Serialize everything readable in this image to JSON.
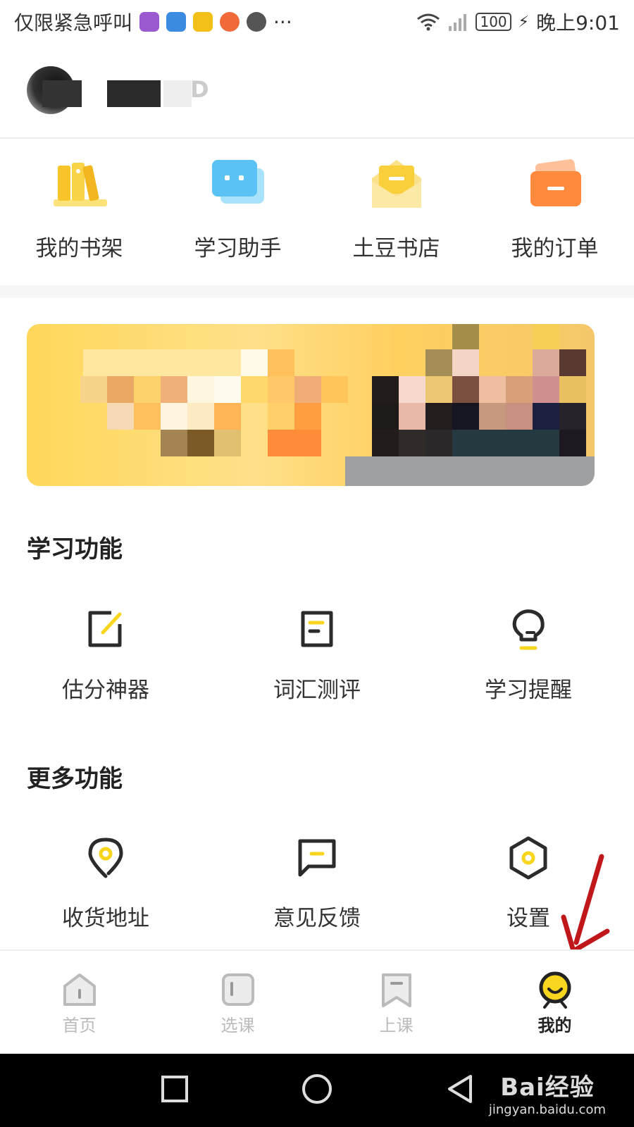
{
  "status_bar": {
    "carrier": "仅限紧急呼叫",
    "app_icon_colors": [
      "#9b59d0",
      "#3b8be0",
      "#f2c018",
      "#f06a3a",
      "#555555"
    ],
    "more": "···",
    "battery": "100",
    "time": "晚上9:01"
  },
  "profile": {
    "name_visible_fragment": "D"
  },
  "quick_actions": [
    {
      "label": "我的书架",
      "icon": "bookshelf-icon",
      "color": "#f7c52a"
    },
    {
      "label": "学习助手",
      "icon": "chat-assistant-icon",
      "color": "#5bc2f5"
    },
    {
      "label": "土豆书店",
      "icon": "envelope-store-icon",
      "color": "#f9cf3c"
    },
    {
      "label": "我的订单",
      "icon": "wallet-order-icon",
      "color": "#ff8a3d"
    }
  ],
  "study_section": {
    "title": "学习功能",
    "items": [
      {
        "label": "估分神器",
        "icon": "edit-icon"
      },
      {
        "label": "词汇测评",
        "icon": "document-icon"
      },
      {
        "label": "学习提醒",
        "icon": "lightbulb-icon"
      }
    ]
  },
  "more_section": {
    "title": "更多功能",
    "items": [
      {
        "label": "收货地址",
        "icon": "location-pin-icon"
      },
      {
        "label": "意见反馈",
        "icon": "feedback-icon"
      },
      {
        "label": "设置",
        "icon": "settings-hex-icon"
      }
    ]
  },
  "tabbar": {
    "tabs": [
      {
        "label": "首页",
        "icon": "home-icon",
        "active": false
      },
      {
        "label": "选课",
        "icon": "course-icon",
        "active": false
      },
      {
        "label": "上课",
        "icon": "class-bookmark-icon",
        "active": false
      },
      {
        "label": "我的",
        "icon": "profile-face-icon",
        "active": true
      }
    ]
  },
  "watermark": {
    "brand": "Bai经验",
    "url": "jingyan.baidu.com"
  },
  "colors": {
    "accent": "#f8d51e",
    "icon_dark": "#2b2b2b",
    "annotation_arrow": "#c0171b"
  }
}
